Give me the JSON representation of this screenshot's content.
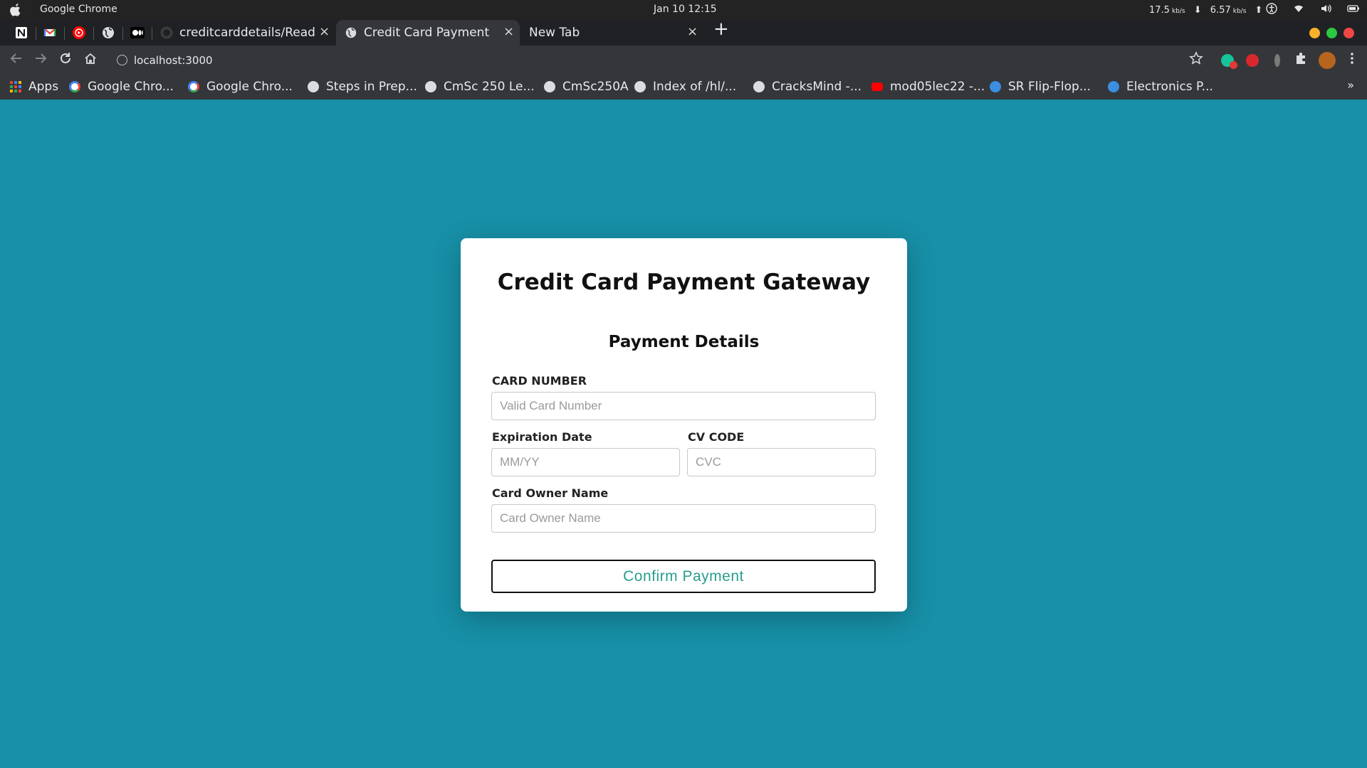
{
  "os": {
    "app_name": "Google Chrome",
    "clock": "Jan 10  12:15",
    "net_down": "17.5",
    "net_up": "6.57",
    "net_unit": "kb/s"
  },
  "tabs": [
    {
      "title": "creditcarddetails/Readm",
      "close": "×"
    },
    {
      "title": "Credit Card Payment",
      "close": "×"
    },
    {
      "title": "New Tab",
      "close": "×"
    }
  ],
  "new_tab": "+",
  "address": {
    "url": "localhost:3000"
  },
  "bookmarks": [
    {
      "label": "Apps",
      "icon": "apps-grid-icon",
      "color": "#e8453c"
    },
    {
      "label": "Google Chro...",
      "icon": "google-icon",
      "color": "#ffffff"
    },
    {
      "label": "Google Chro...",
      "icon": "google-icon",
      "color": "#ffffff"
    },
    {
      "label": "Steps in Prep...",
      "icon": "globe-icon",
      "color": "#dadce0"
    },
    {
      "label": "CmSc 250 Le...",
      "icon": "globe-icon",
      "color": "#dadce0"
    },
    {
      "label": "CmSc250A",
      "icon": "globe-icon",
      "color": "#dadce0"
    },
    {
      "label": "Index of /hl/...",
      "icon": "globe-icon",
      "color": "#dadce0"
    },
    {
      "label": "CracksMind -...",
      "icon": "globe-icon",
      "color": "#dadce0"
    },
    {
      "label": "mod05lec22 -...",
      "icon": "youtube-icon",
      "color": "#ff0000"
    },
    {
      "label": "SR Flip-Flop...",
      "icon": "web-globe-icon",
      "color": "#3b8ee0"
    },
    {
      "label": "Electronics P...",
      "icon": "web-globe-icon",
      "color": "#3b8ee0"
    }
  ],
  "bookmarks_more": "»",
  "page": {
    "title": "Credit Card Payment Gateway",
    "subtitle": "Payment Details",
    "card_number": {
      "label": "CARD NUMBER",
      "placeholder": "Valid Card Number",
      "value": ""
    },
    "expiry": {
      "label": "Expiration Date",
      "placeholder": "MM/YY",
      "value": ""
    },
    "cvc": {
      "label": "CV CODE",
      "placeholder": "CVC",
      "value": ""
    },
    "owner": {
      "label": "Card Owner Name",
      "placeholder": "Card Owner Name",
      "value": ""
    },
    "confirm_label": "Confirm Payment"
  },
  "colors": {
    "page_background": "#1790a8",
    "button_text": "#2a9d8f",
    "window_minimize": "#f6b22b",
    "window_maximize": "#2bc840",
    "window_close": "#f04646"
  }
}
